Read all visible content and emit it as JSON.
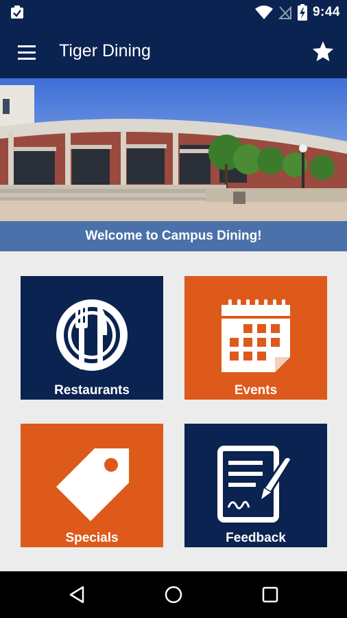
{
  "status_bar": {
    "time": "9:44",
    "icons": [
      "clipboard-check-icon",
      "wifi-icon",
      "no-signal-icon",
      "battery-charging-icon"
    ]
  },
  "app_bar": {
    "title": "Tiger Dining",
    "menu_icon": "hamburger-menu-icon",
    "favorite_icon": "star-icon"
  },
  "banner": {
    "welcome_text": "Welcome to Campus Dining!"
  },
  "tiles": [
    {
      "label": "Restaurants",
      "icon": "plate-utensils-icon",
      "color": "#0b2350"
    },
    {
      "label": "Events",
      "icon": "calendar-icon",
      "color": "#dd5a1a"
    },
    {
      "label": "Specials",
      "icon": "price-tag-icon",
      "color": "#dd5a1a"
    },
    {
      "label": "Feedback",
      "icon": "signed-document-icon",
      "color": "#0b2350"
    }
  ],
  "nav_bar": {
    "buttons": [
      "back-icon",
      "home-icon",
      "recents-icon"
    ]
  },
  "colors": {
    "primary": "#0b2350",
    "accent": "#dd5a1a",
    "banner": "#4a71a9"
  }
}
